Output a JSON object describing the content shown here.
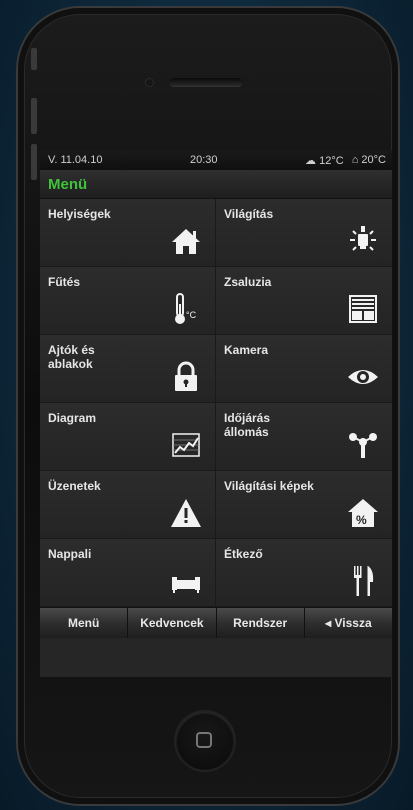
{
  "status": {
    "date": "V. 11.04.10",
    "time": "20:30",
    "outdoor_temp": "12°C",
    "indoor_temp": "20°C"
  },
  "title": "Menü",
  "tiles": [
    {
      "label": "Helyiségek",
      "icon": "house-icon"
    },
    {
      "label": "Világítás",
      "icon": "light-bulb-icon"
    },
    {
      "label": "Fűtés",
      "icon": "thermometer-icon"
    },
    {
      "label": "Zsaluzia",
      "icon": "blinds-icon"
    },
    {
      "label": "Ajtók és ablakok",
      "icon": "padlock-icon"
    },
    {
      "label": "Kamera",
      "icon": "eye-icon"
    },
    {
      "label": "Diagram",
      "icon": "chart-icon"
    },
    {
      "label": "Időjárás állomás",
      "icon": "anemometer-icon"
    },
    {
      "label": "Üzenetek",
      "icon": "warning-icon"
    },
    {
      "label": "Világítási képek",
      "icon": "house-percent-icon"
    },
    {
      "label": "Nappali",
      "icon": "sofa-icon"
    },
    {
      "label": "Étkező",
      "icon": "fork-knife-icon"
    }
  ],
  "tabs": {
    "menu": "Menü",
    "favorites": "Kedvencek",
    "system": "Rendszer",
    "back": "◂ Vissza"
  },
  "colors": {
    "accent": "#3ec43a",
    "screen_bg": "#262626"
  }
}
